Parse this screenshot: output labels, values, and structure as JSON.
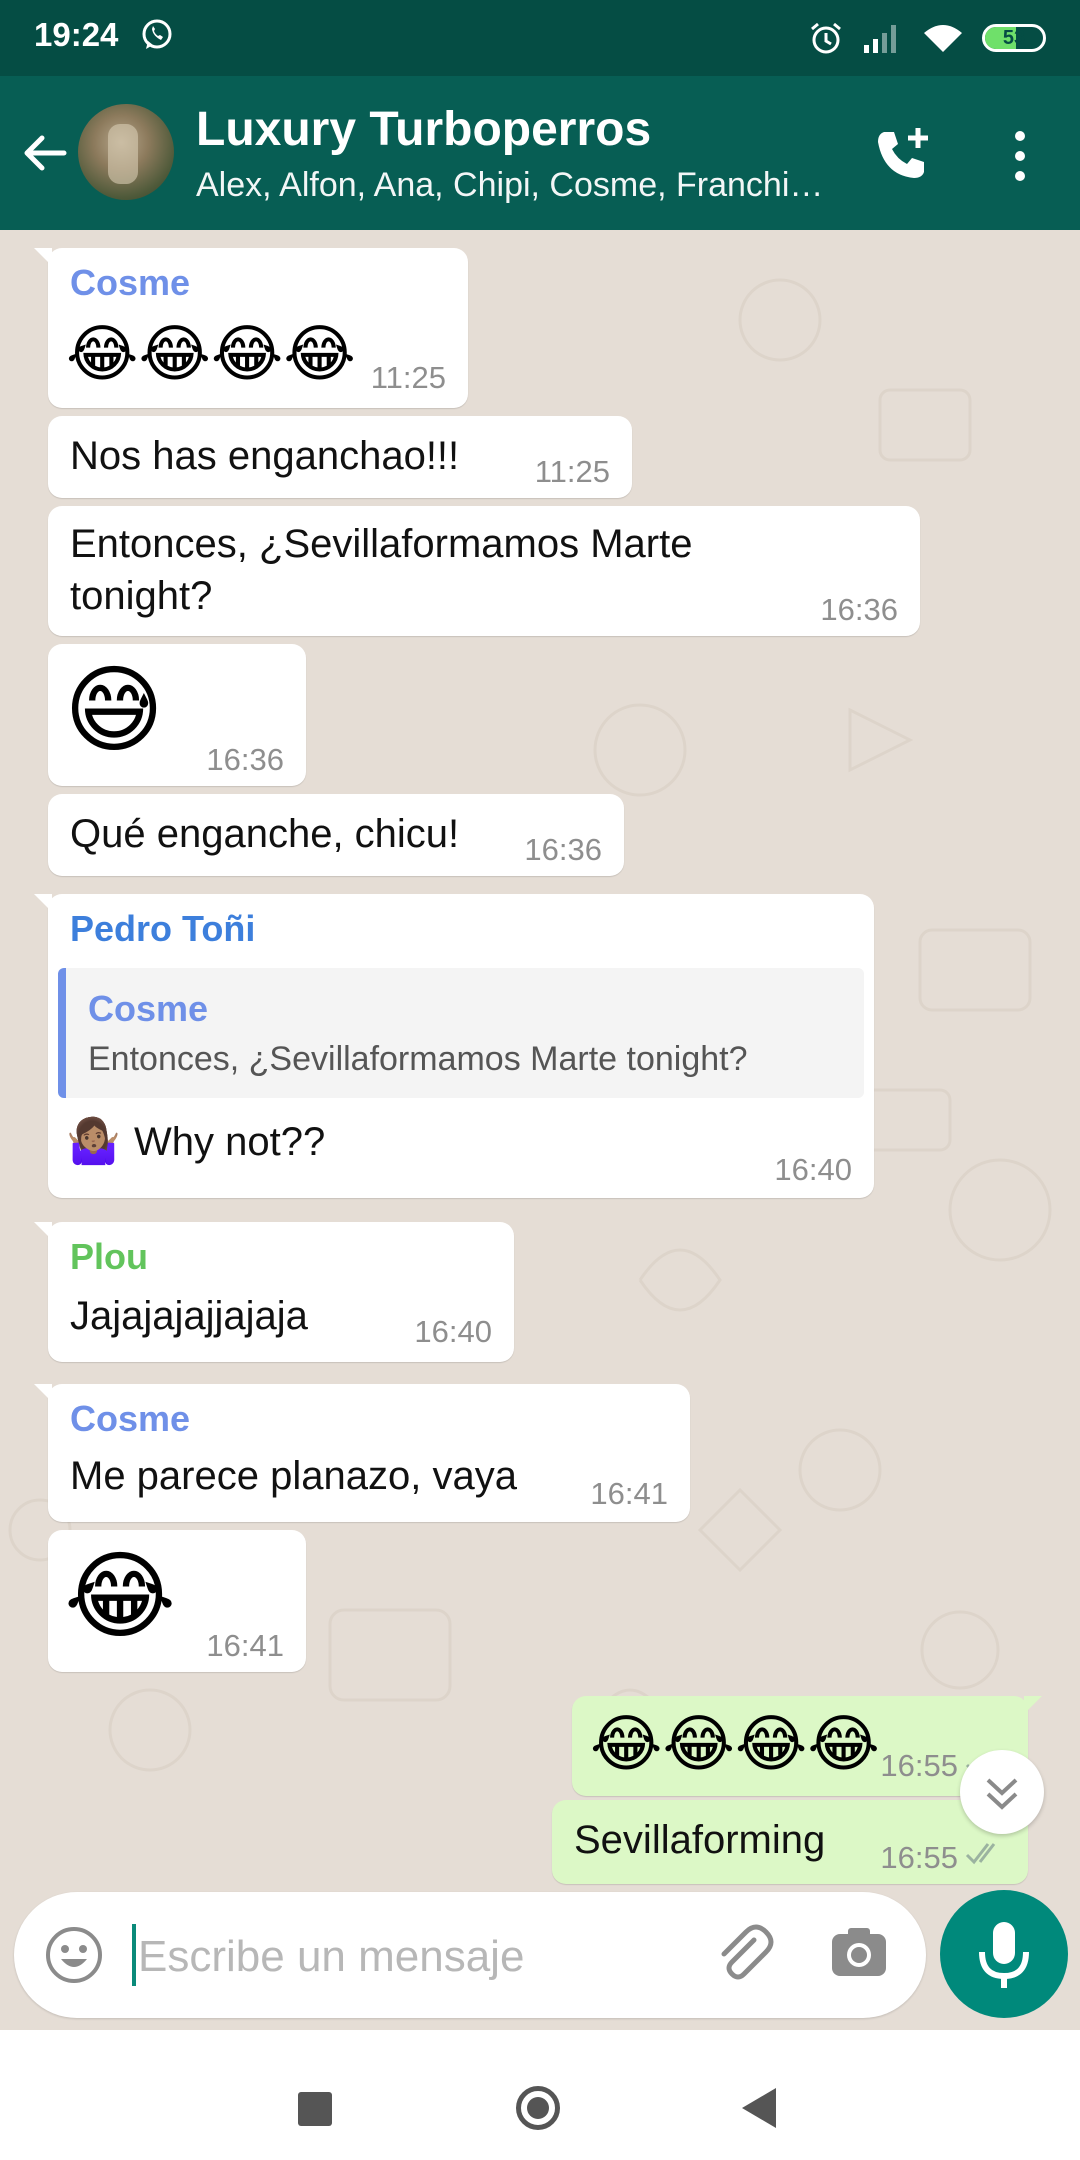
{
  "status_bar": {
    "time": "19:24",
    "battery": "53",
    "battery_level": 0.53
  },
  "header": {
    "title": "Luxury Turboperros",
    "subtitle": "Alex, Alfon, Ana, Chipi, Cosme, Franchi…"
  },
  "messages": [
    {
      "sender": "Cosme",
      "sender_color": "#6f90e8",
      "text": "😂😂😂😂",
      "time": "11:25"
    },
    {
      "text": "Nos has enganchao!!!",
      "time": "11:25"
    },
    {
      "text_line1": "Entonces, ¿Sevillaformamos Marte",
      "text_line2": "tonight?",
      "time": "16:36"
    },
    {
      "text": "😅",
      "time": "16:36"
    },
    {
      "text": "Qué enganche, chicu!",
      "time": "16:36"
    },
    {
      "sender": "Pedro Toñi",
      "sender_color": "#3d7fdc",
      "quote_sender": "Cosme",
      "quote_text": "Entonces, ¿Sevillaformamos Marte tonight?",
      "text_emoji": "🤷🏽‍♀️",
      "text": "Why not??",
      "time": "16:40"
    },
    {
      "sender": "Plou",
      "sender_color": "#62c45c",
      "text": "Jajajajajjajaja",
      "time": "16:40"
    },
    {
      "sender": "Cosme",
      "sender_color": "#6f90e8",
      "text": "Me parece planazo, vaya",
      "time": "16:41"
    },
    {
      "text": "😂",
      "time": "16:41"
    },
    {
      "text": "😂😂😂😂",
      "time": "16:55",
      "outgoing": true
    },
    {
      "text": "Sevillaforming",
      "time": "16:55",
      "outgoing": true
    }
  ],
  "composer": {
    "placeholder": "Escribe un mensaje"
  },
  "icons": {
    "status": [
      "whatsapp-icon",
      "alarm-icon",
      "signal-icon",
      "wifi-icon",
      "battery-icon"
    ],
    "header": [
      "back-arrow-icon",
      "add-call-icon",
      "more-vert-icon"
    ],
    "composer": [
      "emoji-icon",
      "attach-icon",
      "camera-icon",
      "mic-icon"
    ]
  },
  "colors": {
    "header": "#075e54",
    "status_bar": "#054d44",
    "outgoing_bubble": "#dcf8c6",
    "accent": "#00897b",
    "chat_bg": "#e5ddd5"
  }
}
